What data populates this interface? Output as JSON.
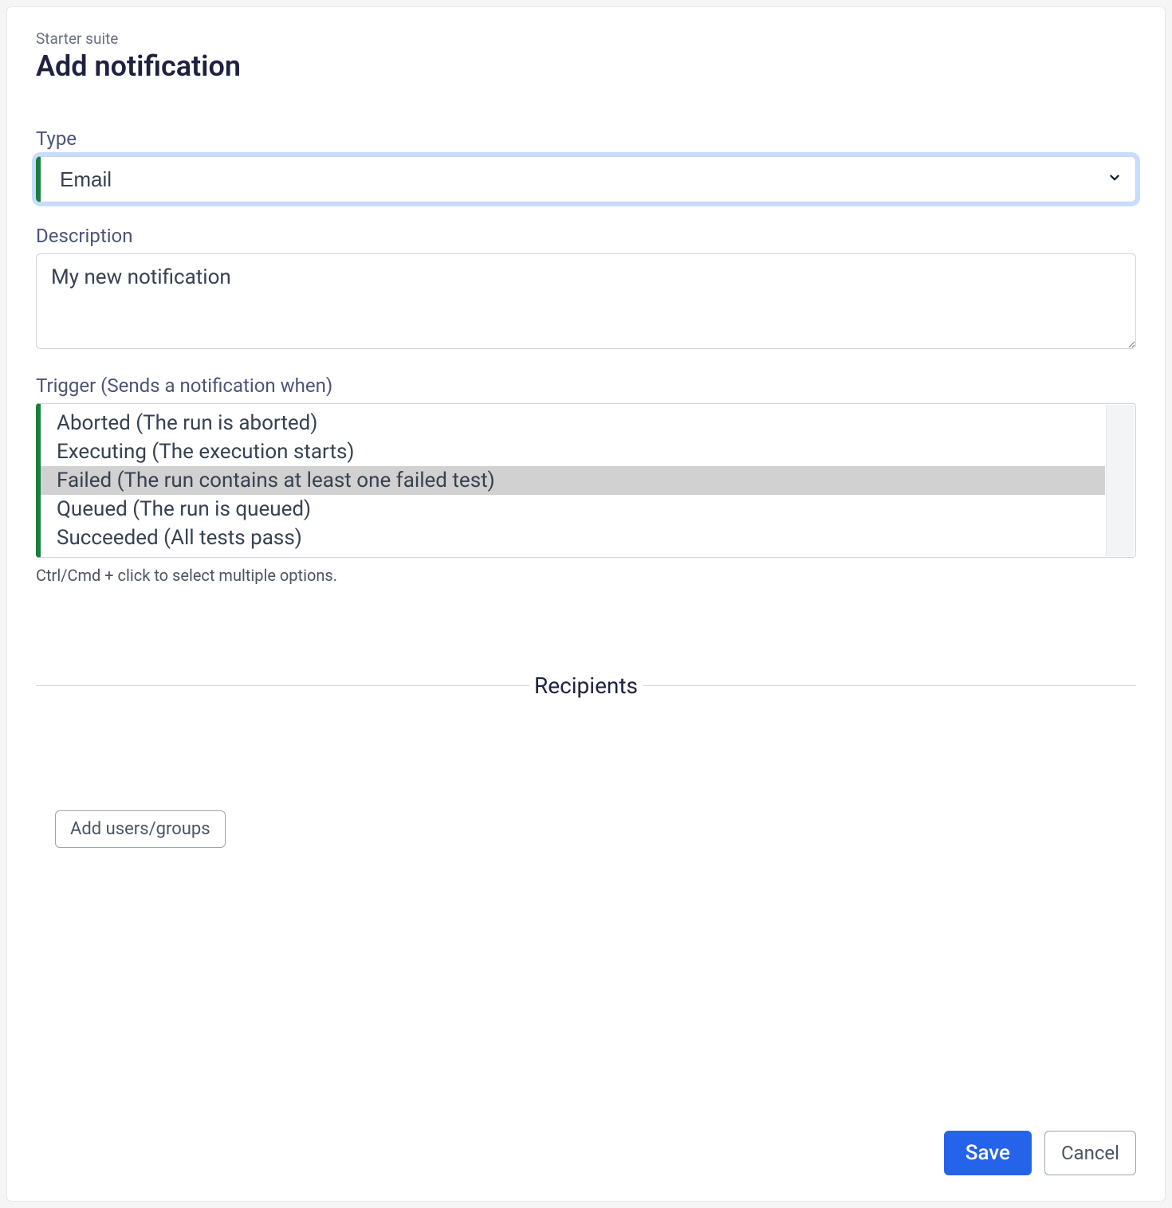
{
  "header": {
    "breadcrumb": "Starter suite",
    "title": "Add notification"
  },
  "type_field": {
    "label": "Type",
    "value": "Email"
  },
  "description_field": {
    "label": "Description",
    "value": "My new notification"
  },
  "trigger_field": {
    "label": "Trigger (Sends a notification when)",
    "options": [
      {
        "label": "Aborted (The run is aborted)",
        "selected": false
      },
      {
        "label": "Executing (The execution starts)",
        "selected": false
      },
      {
        "label": "Failed (The run contains at least one failed test)",
        "selected": true
      },
      {
        "label": "Queued (The run is queued)",
        "selected": false
      },
      {
        "label": "Succeeded (All tests pass)",
        "selected": false
      }
    ],
    "help": "Ctrl/Cmd + click to select multiple options."
  },
  "recipients_section": {
    "title": "Recipients",
    "add_button": "Add users/groups"
  },
  "footer": {
    "save": "Save",
    "cancel": "Cancel"
  }
}
